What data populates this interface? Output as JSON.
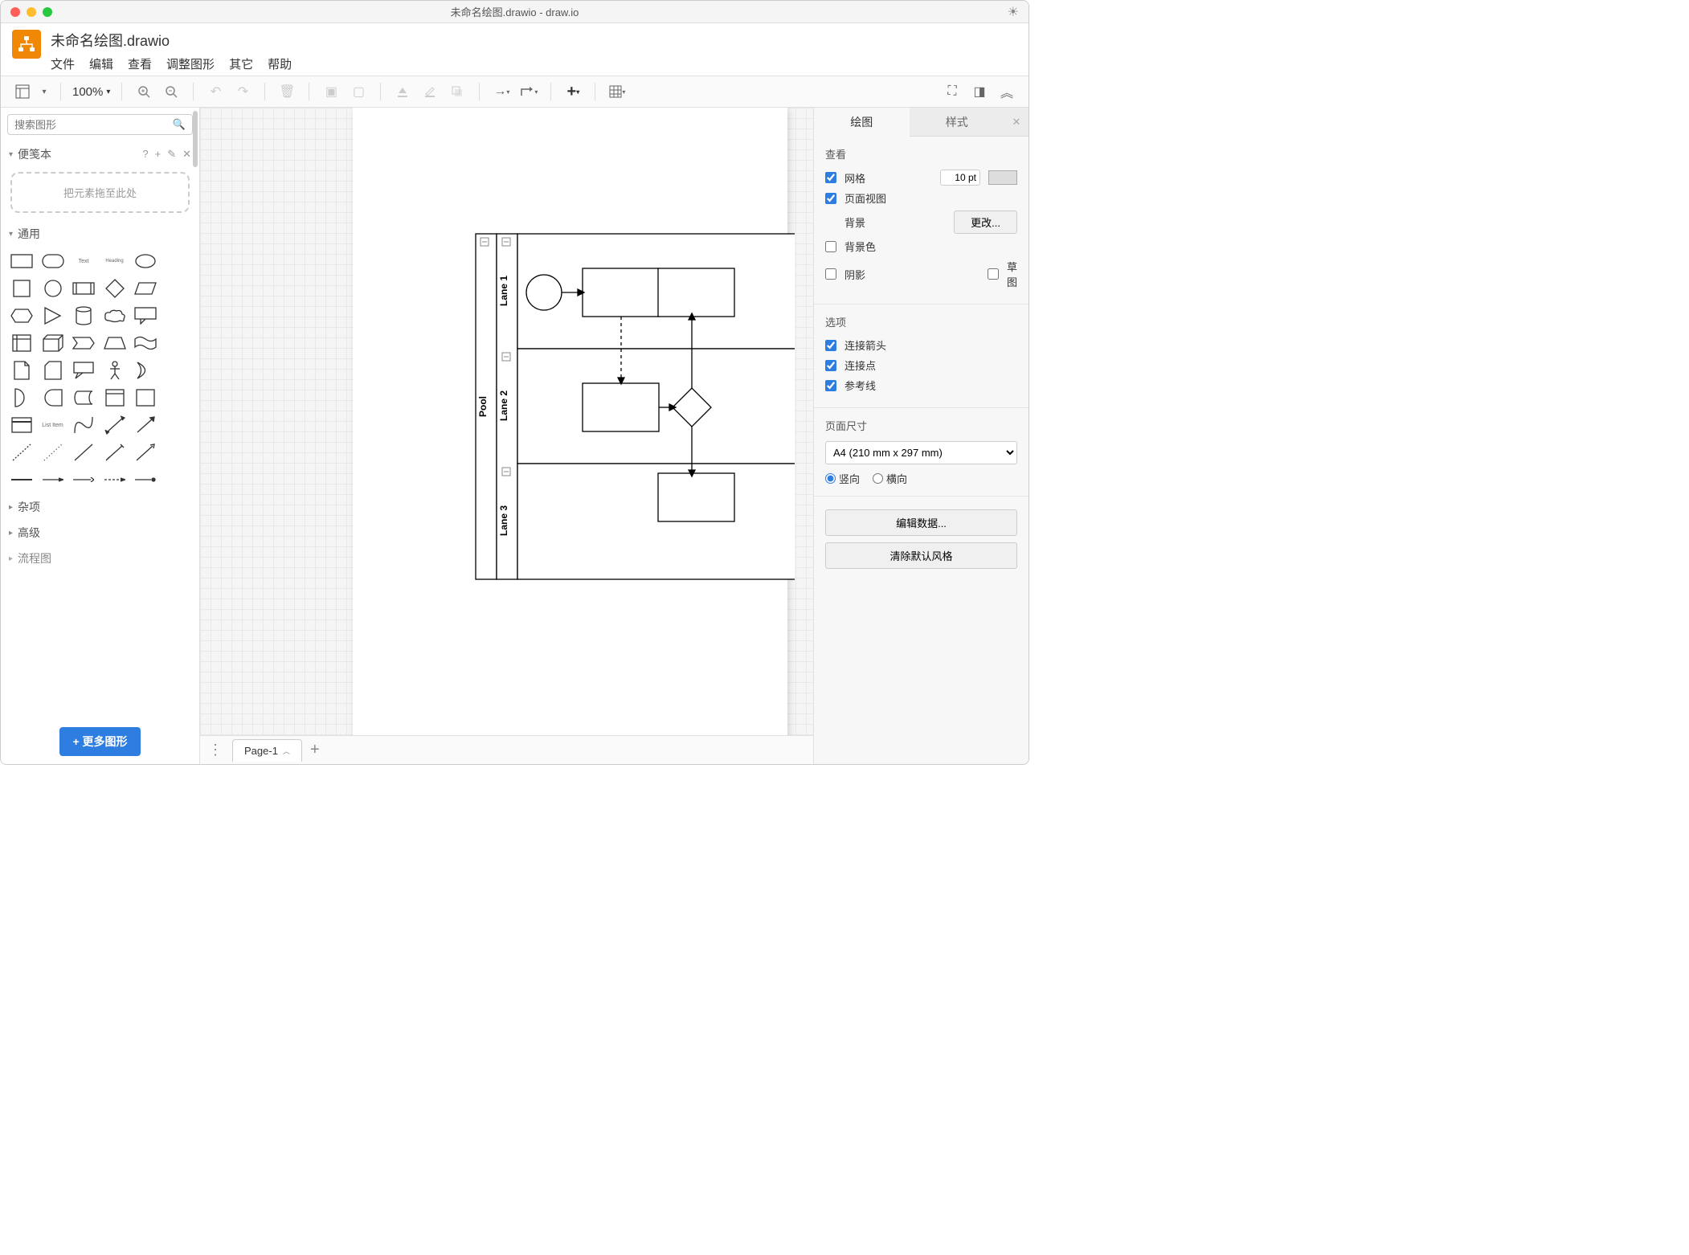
{
  "window_title": "未命名绘图.drawio - draw.io",
  "doc_name": "未命名绘图.drawio",
  "menubar": [
    "文件",
    "编辑",
    "查看",
    "调整图形",
    "其它",
    "帮助"
  ],
  "toolbar": {
    "zoom": "100%"
  },
  "sidebar": {
    "search_placeholder": "搜索图形",
    "scratchpad_title": "便笺本",
    "scratchpad_hint": "把元素拖至此处",
    "general_title": "通用",
    "misc_title": "杂项",
    "advanced_title": "高级",
    "flowchart_title": "流程图",
    "more_shapes": "+ 更多图形",
    "shape_text_label": "Text",
    "shape_heading_label": "Heading",
    "shape_list_item": "List Item"
  },
  "canvas": {
    "pool_label": "Pool",
    "lanes": [
      "Lane 1",
      "Lane 2",
      "Lane 3"
    ]
  },
  "pagebar": {
    "page1": "Page-1"
  },
  "right": {
    "tab_diagram": "绘图",
    "tab_style": "样式",
    "view_section": "查看",
    "grid_label": "网格",
    "grid_value": "10 pt",
    "pageview_label": "页面视图",
    "background_label": "背景",
    "change_btn": "更改...",
    "bgcolor_label": "背景色",
    "shadow_label": "阴影",
    "sketch_label": "草图",
    "options_section": "选项",
    "conn_arrows": "连接箭头",
    "conn_points": "连接点",
    "guides": "参考线",
    "pagesize_section": "页面尺寸",
    "pagesize_value": "A4 (210 mm x 297 mm)",
    "portrait": "竖向",
    "landscape": "横向",
    "edit_data": "编辑数据...",
    "clear_default": "清除默认风格"
  }
}
